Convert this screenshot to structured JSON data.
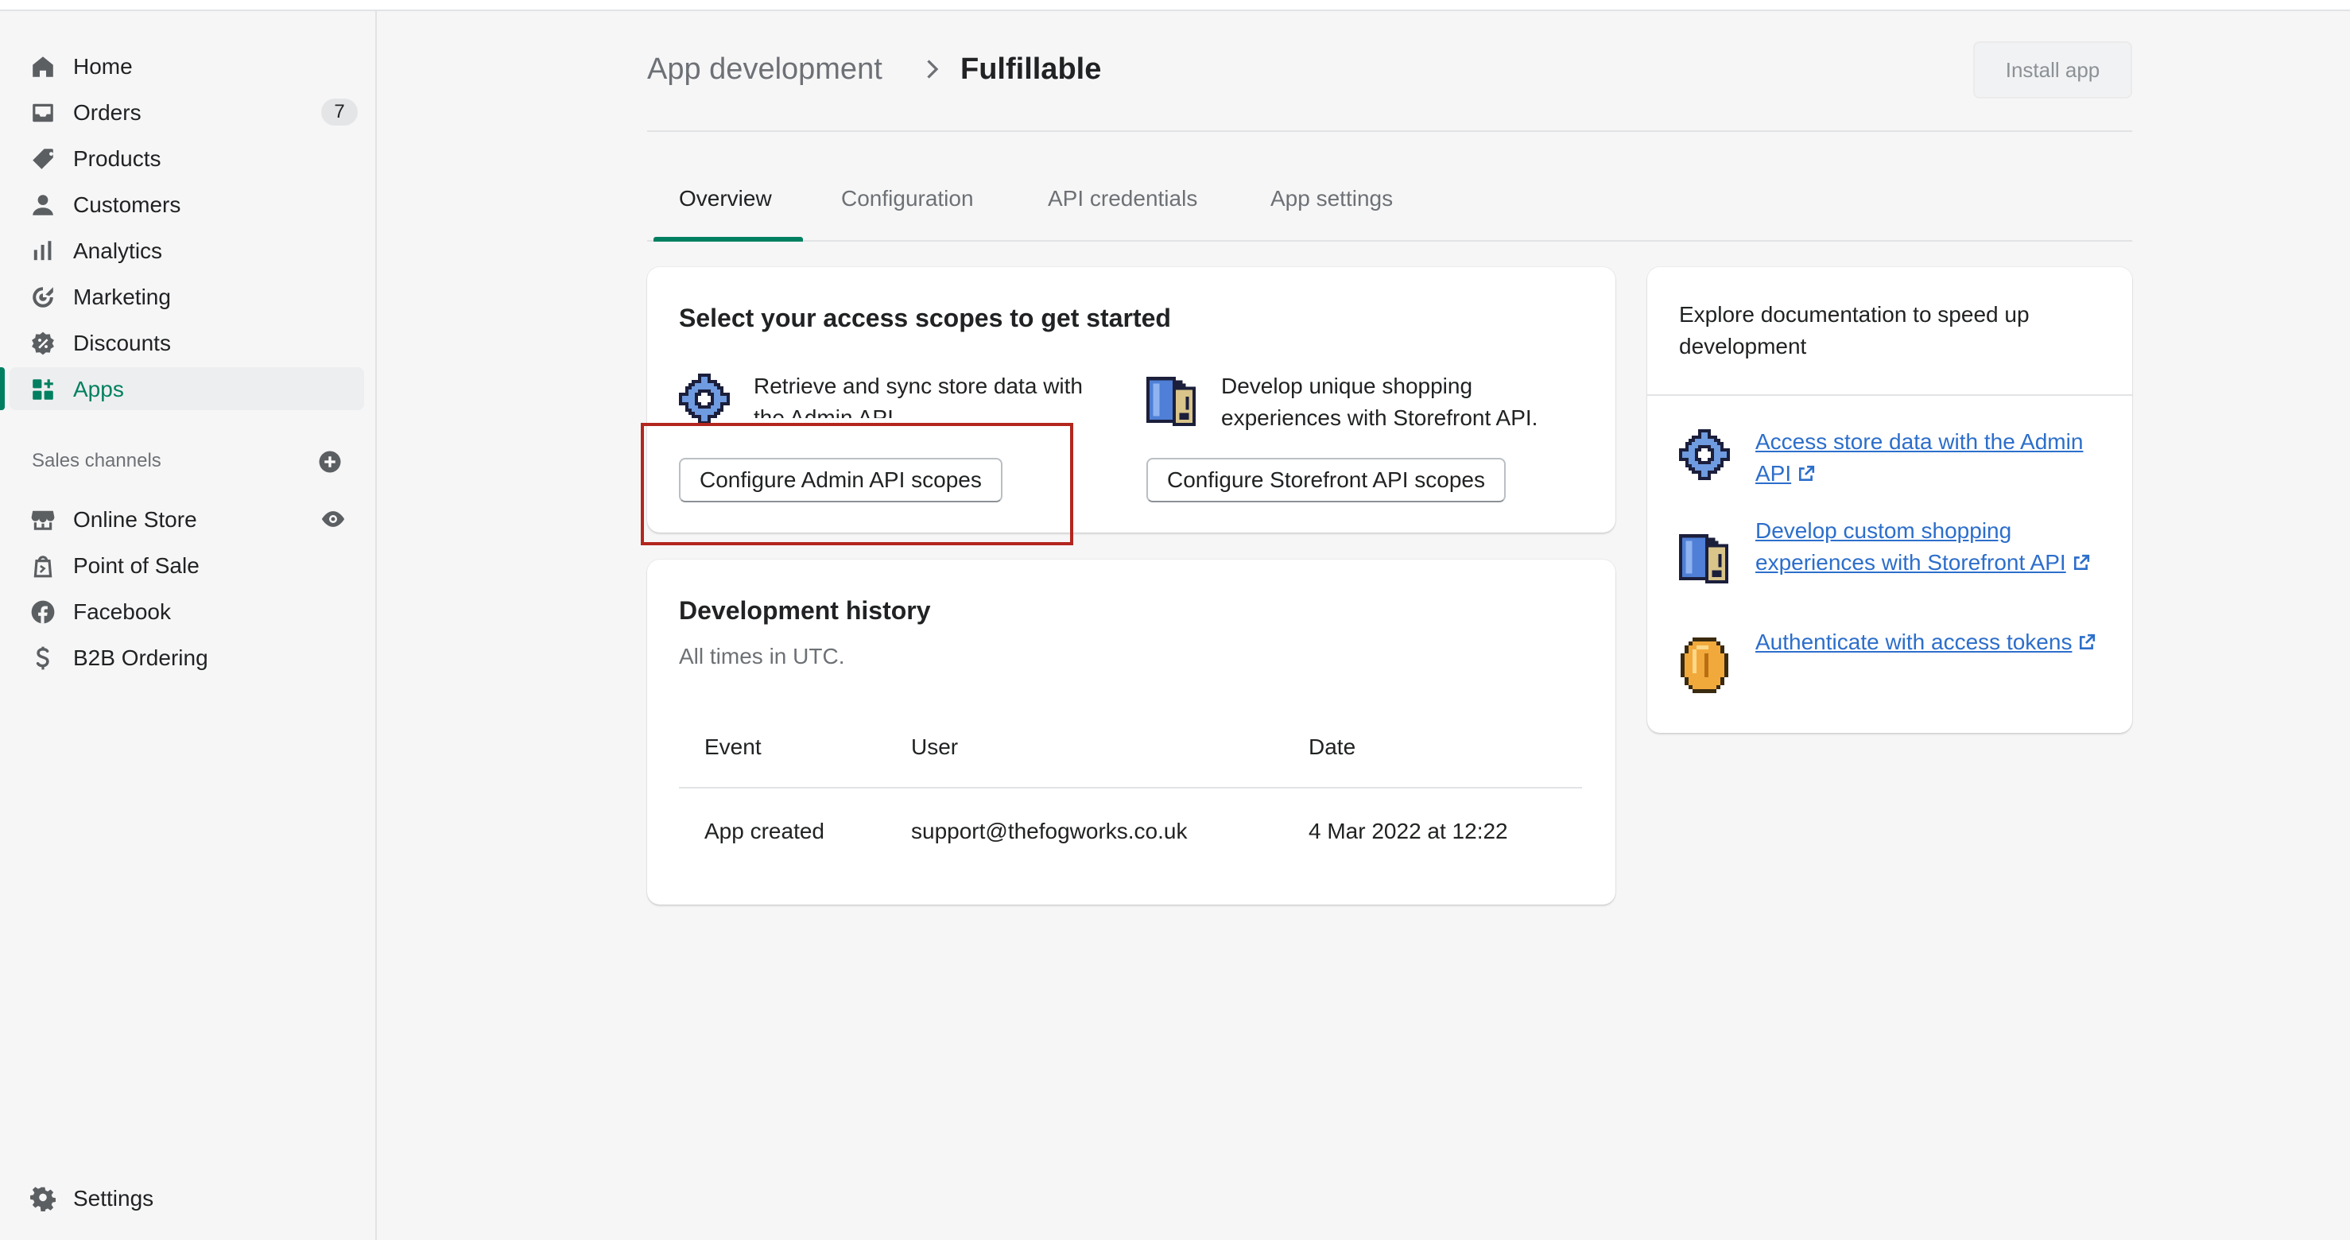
{
  "sidebar": {
    "items": [
      {
        "label": "Home",
        "icon": "home-icon"
      },
      {
        "label": "Orders",
        "icon": "orders-icon",
        "badge": "7"
      },
      {
        "label": "Products",
        "icon": "tag-icon"
      },
      {
        "label": "Customers",
        "icon": "person-icon"
      },
      {
        "label": "Analytics",
        "icon": "bar-chart-icon"
      },
      {
        "label": "Marketing",
        "icon": "target-icon"
      },
      {
        "label": "Discounts",
        "icon": "discount-icon"
      },
      {
        "label": "Apps",
        "icon": "apps-icon",
        "active": true
      }
    ],
    "sales_channels_title": "Sales channels",
    "channels": [
      {
        "label": "Online Store",
        "icon": "store-icon"
      },
      {
        "label": "Point of Sale",
        "icon": "pos-bag-icon"
      },
      {
        "label": "Facebook",
        "icon": "facebook-icon"
      },
      {
        "label": "B2B Ordering",
        "icon": "b2b-icon"
      }
    ],
    "settings_label": "Settings"
  },
  "header": {
    "breadcrumb_parent": "App development",
    "title": "Fulfillable",
    "install_label": "Install app"
  },
  "tabs": [
    {
      "label": "Overview",
      "active": true
    },
    {
      "label": "Configuration"
    },
    {
      "label": "API credentials"
    },
    {
      "label": "App settings"
    }
  ],
  "scopes_card": {
    "title": "Select your access scopes to get started",
    "admin_desc": "Retrieve and sync store data with the Admin API.",
    "admin_button": "Configure Admin API scopes",
    "storefront_desc": "Develop unique shopping experiences with Storefront API.",
    "storefront_button": "Configure Storefront API scopes"
  },
  "history_card": {
    "title": "Development history",
    "subtitle": "All times in UTC.",
    "columns": [
      "Event",
      "User",
      "Date"
    ],
    "rows": [
      {
        "event": "App created",
        "user": "support@thefogworks.co.uk",
        "date": "4 Mar 2022 at 12:22"
      }
    ]
  },
  "docs_card": {
    "heading": "Explore documentation to speed up development",
    "links": [
      {
        "label": "Access store data with the Admin API",
        "icon": "gear-pixel-icon"
      },
      {
        "label": "Develop custom shopping experiences with Storefront API",
        "icon": "storefront-pixel-icon"
      },
      {
        "label": "Authenticate with access tokens",
        "icon": "coin-pixel-icon"
      }
    ]
  },
  "colors": {
    "accent": "#008060",
    "link": "#2c6ecb",
    "highlight": "#b3261e"
  }
}
